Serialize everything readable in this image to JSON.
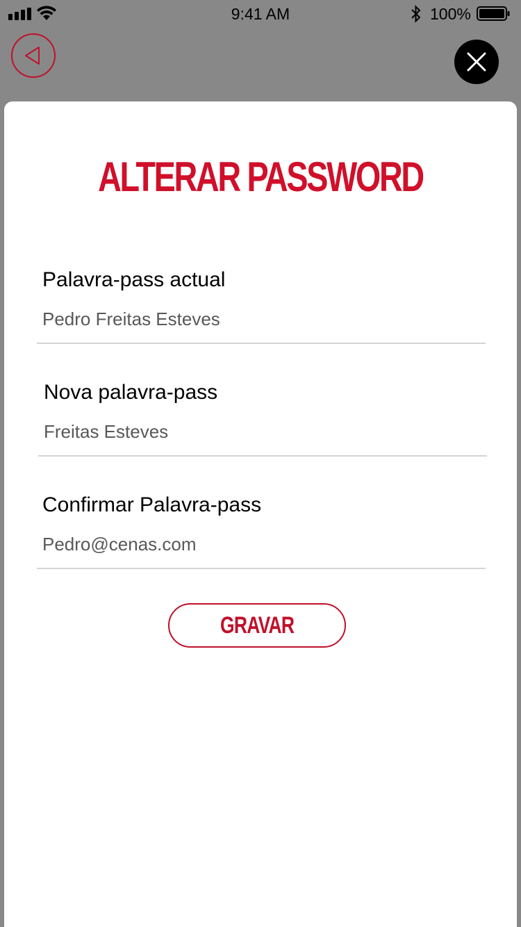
{
  "status_bar": {
    "time": "9:41 AM",
    "battery_percent": "100%",
    "icons": [
      "signal-icon",
      "wifi-icon",
      "bluetooth-icon",
      "battery-icon"
    ]
  },
  "header": {
    "back_icon": "back-arrow-icon",
    "close_icon": "close-icon"
  },
  "sheet": {
    "title": "ALTERAR PASSWORD",
    "fields": [
      {
        "label": "Palavra-pass actual",
        "value": "Pedro Freitas Esteves"
      },
      {
        "label": "Nova palavra-pass",
        "value": "Freitas Esteves"
      },
      {
        "label": "Confirmar Palavra-pass",
        "value": "Pedro@cenas.com"
      }
    ],
    "save_label": "GRAVAR"
  },
  "colors": {
    "accent": "#d0102a",
    "overlay": "#888888"
  }
}
